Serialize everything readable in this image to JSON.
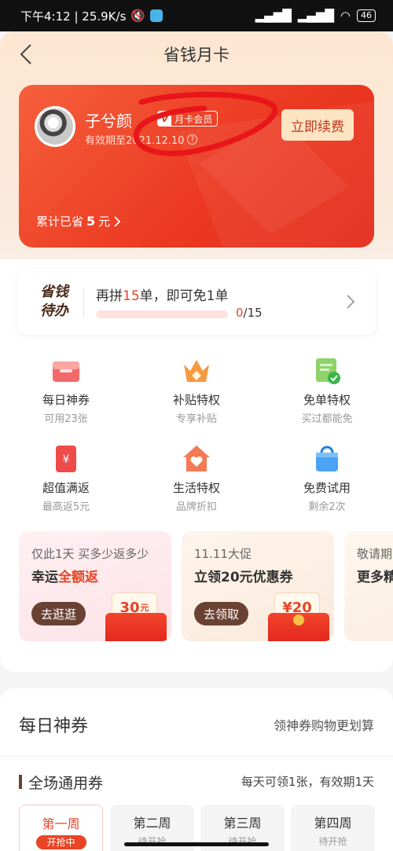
{
  "status_bar": {
    "time_speed": "下午4:12 | 25.9K/s",
    "battery": "46"
  },
  "nav": {
    "title": "省钱月卡",
    "back_icon": "chevron-left-icon"
  },
  "member_card": {
    "username": "子兮颜",
    "badge_letter": "V",
    "badge_label": "月卡会员",
    "expiry_text": "有效期至2021.12.10",
    "renew_label": "立即续费",
    "saved_prefix": "累计已省",
    "saved_amount": "5",
    "saved_suffix": "元",
    "colors": {
      "card": "#ec3a22",
      "renew_bg": "#fde5c3",
      "scribble": "#e8161a"
    }
  },
  "todo": {
    "tag_line1": "省钱",
    "tag_line2": "待办",
    "text_prefix": "再拼",
    "text_count": "15",
    "text_suffix": "单，即可免1单",
    "progress_done": "0",
    "progress_total": "/15",
    "progress_fraction": 0
  },
  "features": [
    {
      "title": "每日神券",
      "sub": "可用23张",
      "icon": "coupon-box-icon"
    },
    {
      "title": "补贴特权",
      "sub": "专享补贴",
      "icon": "crown-icon"
    },
    {
      "title": "免单特权",
      "sub": "买过都能免",
      "icon": "checked-document-icon"
    },
    {
      "title": "超值满返",
      "sub": "最高返5元",
      "icon": "yuan-envelope-icon"
    },
    {
      "title": "生活特权",
      "sub": "品牌折扣",
      "icon": "heart-house-icon"
    },
    {
      "title": "免费试用",
      "sub": "剩余2次",
      "icon": "shopping-bag-icon"
    }
  ],
  "promos": [
    {
      "line1": "仅此1天 买多少返多少",
      "line2_prefix": "幸运",
      "line2_hl": "全额返",
      "button": "去逛逛",
      "amount": "30",
      "unit": "元"
    },
    {
      "line1": "11.11大促",
      "line2_prefix": "立领20元优惠券",
      "line2_hl": "",
      "button": "去领取",
      "amount": "¥20",
      "unit": ""
    },
    {
      "line1": "敬请期",
      "line2_prefix": "更多精",
      "line2_hl": "",
      "button": "",
      "amount": "",
      "unit": ""
    }
  ],
  "coupon_section": {
    "title": "每日神券",
    "subtitle": "领神券购物更划算",
    "sub_title": "全场通用券",
    "sub_note": "每天可领1张，有效期1天",
    "weeks": [
      {
        "label": "第一周",
        "status": "开抢中",
        "active": true
      },
      {
        "label": "第二周",
        "status": "待开抢",
        "active": false
      },
      {
        "label": "第三周",
        "status": "待开抢",
        "active": false
      },
      {
        "label": "第四周",
        "status": "待开抢",
        "active": false
      }
    ]
  }
}
